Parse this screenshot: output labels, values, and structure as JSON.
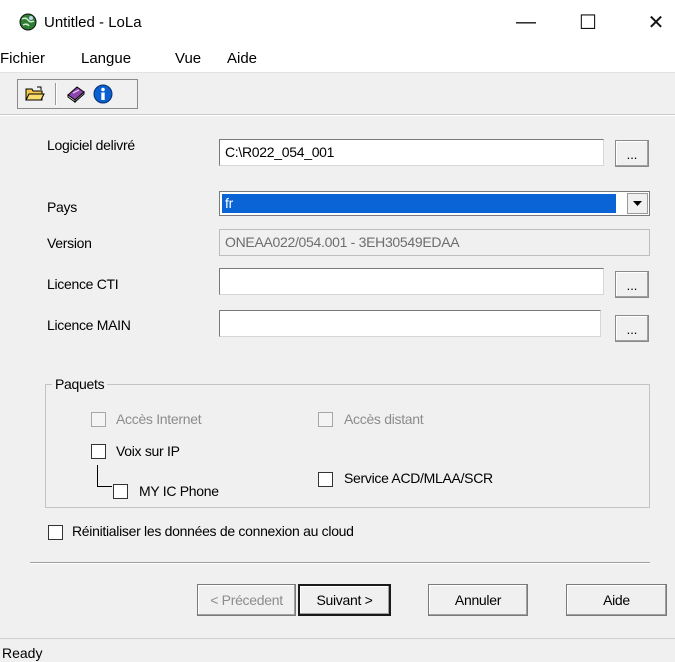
{
  "window": {
    "title": "Untitled - LoLa",
    "minimize_glyph": "—",
    "maximize_glyph": "☐",
    "close_glyph": "✕"
  },
  "menu": {
    "items": [
      "Fichier",
      "Langue",
      "Vue",
      "Aide"
    ]
  },
  "toolbar": {
    "icons": [
      "open-folder-icon",
      "book-icon",
      "info-icon"
    ]
  },
  "form": {
    "logiciel": {
      "label": "Logiciel delivré",
      "value": "C:\\R022_054_001",
      "browse": "..."
    },
    "pays": {
      "label": "Pays",
      "value": "fr"
    },
    "version": {
      "label": "Version",
      "value": "ONEAA022/054.001 - 3EH30549EDAA"
    },
    "licence_cti": {
      "label": "Licence CTI",
      "value": "",
      "browse": "..."
    },
    "licence_main": {
      "label": "Licence MAIN",
      "value": "",
      "browse": "..."
    }
  },
  "paquets": {
    "title": "Paquets",
    "acces_internet": {
      "label": "Accès Internet",
      "checked": false,
      "enabled": false
    },
    "acces_distant": {
      "label": "Accès distant",
      "checked": false,
      "enabled": false
    },
    "voix_sur_ip": {
      "label": "Voix sur IP",
      "checked": false,
      "enabled": true
    },
    "my_ic_phone": {
      "label": "MY IC Phone",
      "checked": false,
      "enabled": true
    },
    "service_acd": {
      "label": "Service ACD/MLAA/SCR",
      "checked": false,
      "enabled": true
    }
  },
  "reinit": {
    "label": "Réinitialiser les données de connexion au cloud",
    "checked": false
  },
  "buttons": {
    "precedent": "< Précedent",
    "suivant": "Suivant >",
    "annuler": "Annuler",
    "aide": "Aide"
  },
  "status": {
    "text": "Ready"
  },
  "colors": {
    "selection": "#0a64d6",
    "dialog_bg": "#f0f0f0"
  }
}
